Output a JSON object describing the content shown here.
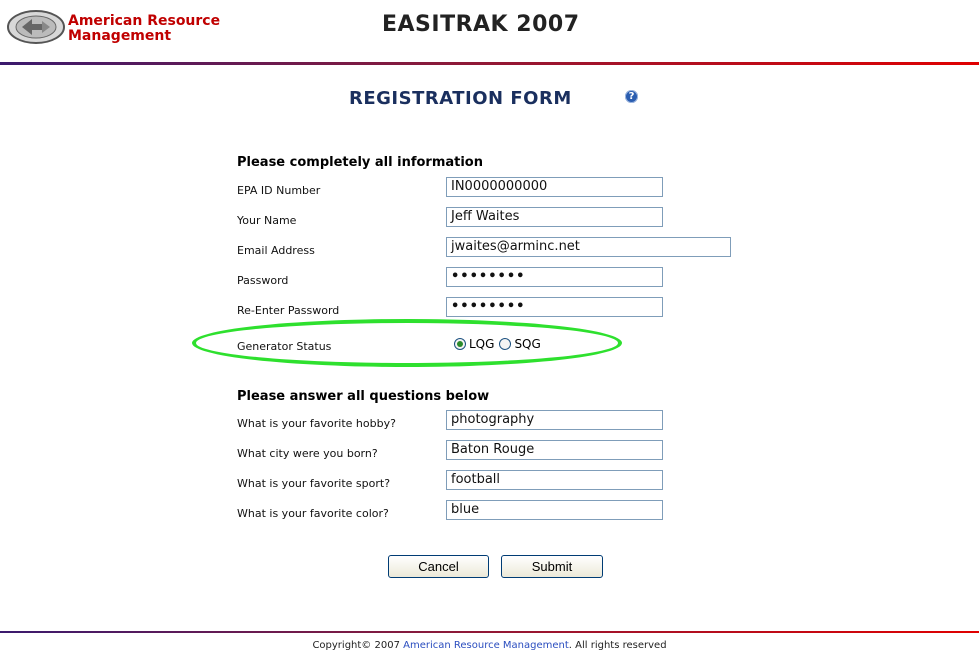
{
  "header": {
    "brand_line1": "American Resource",
    "brand_line2": "Management",
    "app_title": "EASITRAK 2007"
  },
  "form": {
    "title": "REGISTRATION FORM",
    "help_icon": "question-circle-icon",
    "section1_heading": "Please completely all information",
    "fields": {
      "epa_label": "EPA ID Number",
      "epa_value": "IN0000000000",
      "name_label": "Your Name",
      "name_value": "Jeff Waites",
      "email_label": "Email Address",
      "email_value": "jwaites@arminc.net",
      "password_label": "Password",
      "password_value": "••••••••",
      "repassword_label": "Re-Enter Password",
      "repassword_value": "••••••••",
      "generator_label": "Generator Status",
      "generator_options": [
        "LQG",
        "SQG"
      ],
      "generator_selected": "LQG"
    },
    "section2_heading": "Please answer all questions below",
    "questions": {
      "hobby_label": "What is your favorite hobby?",
      "hobby_value": "photography",
      "city_label": "What city were you born?",
      "city_value": "Baton Rouge",
      "sport_label": "What is your favorite sport?",
      "sport_value": "football",
      "color_label": "What is your favorite color?",
      "color_value": "blue"
    },
    "cancel_label": "Cancel",
    "submit_label": "Submit"
  },
  "footer": {
    "prefix": "Copyright© 2007 ",
    "link": "American Resource Management",
    "suffix": ".  All rights reserved"
  },
  "colors": {
    "brand_red": "#c00000",
    "title_navy": "#1a2f5e",
    "highlight_green": "#2ee02e"
  }
}
